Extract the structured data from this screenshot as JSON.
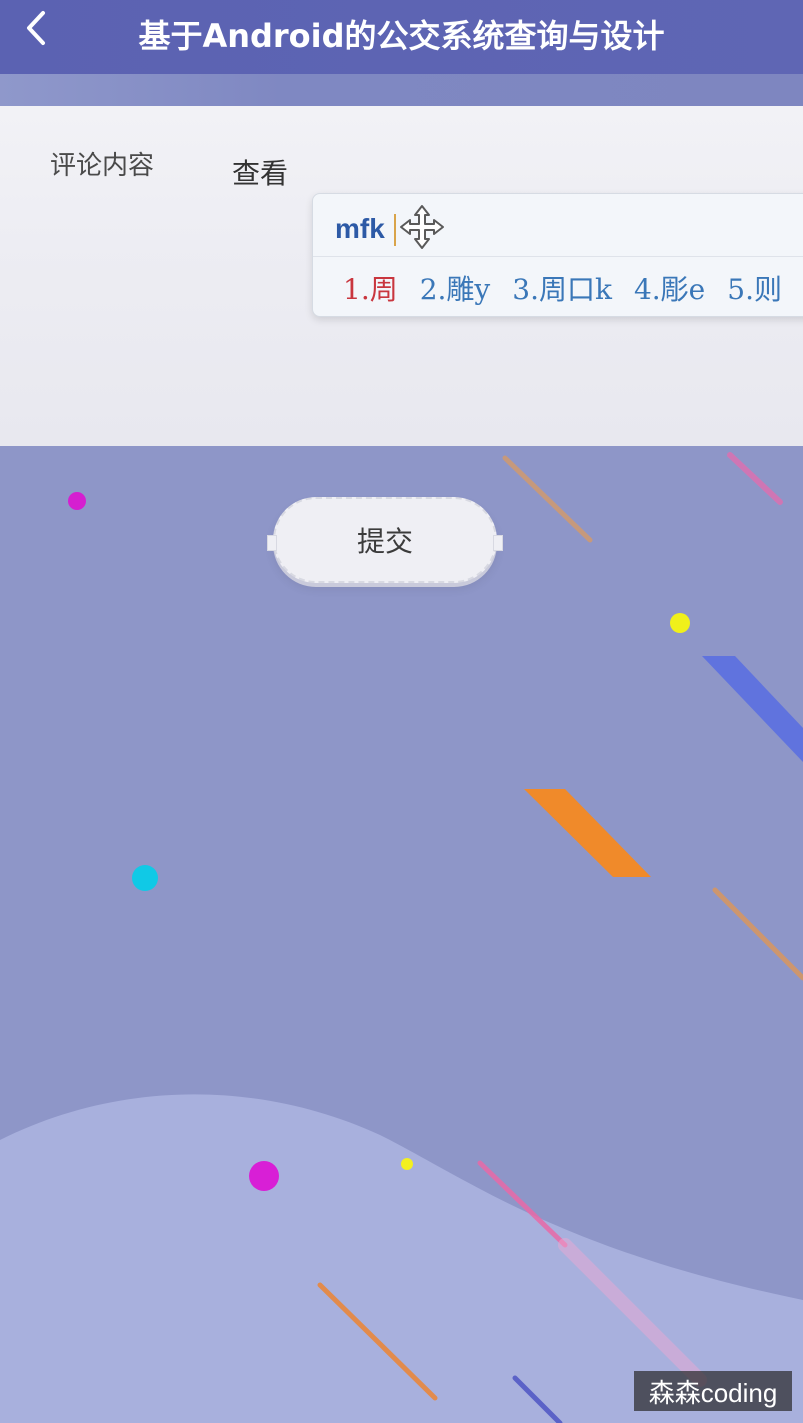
{
  "app_bar": {
    "title": "基于Android的公交系统查询与设计"
  },
  "comment_form": {
    "comment_label": "评论内容",
    "view_button": "查看",
    "submit_button": "提交"
  },
  "ime": {
    "composition": "mfk",
    "candidates": [
      {
        "label": "1.周"
      },
      {
        "label": "2.雕y"
      },
      {
        "label": "3.周口k"
      },
      {
        "label": "4.彫e"
      },
      {
        "label": "5.则"
      }
    ]
  },
  "watermark": "森森coding",
  "colors": {
    "app_bar": "#5b62b2",
    "background": "#8e96c8",
    "card": "#eeeef4",
    "selected_candidate": "#c9363e",
    "candidate": "#3a77b8",
    "composition": "#2d5aa6"
  },
  "icons": {
    "back": "chevron-left-icon",
    "move": "move-arrows-icon"
  }
}
